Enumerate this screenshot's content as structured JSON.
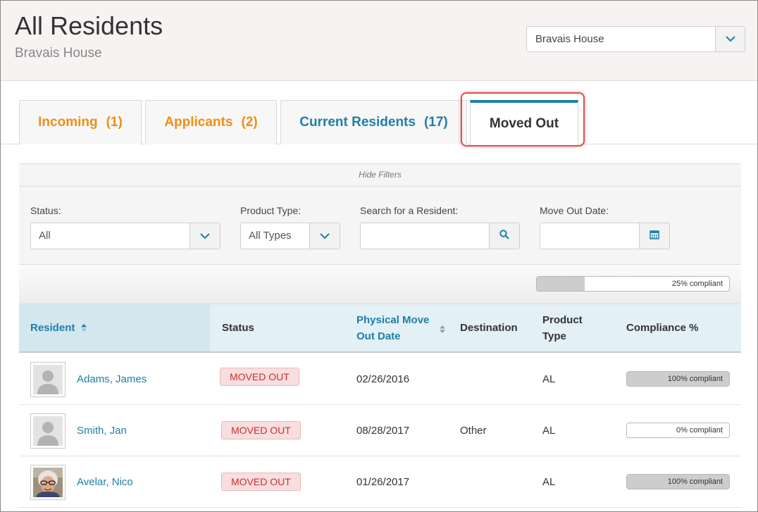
{
  "header": {
    "title": "All Residents",
    "subtitle": "Bravais House",
    "community_select": {
      "value": "Bravais House",
      "icon": "chevron-down-icon"
    }
  },
  "tabs": [
    {
      "label": "Incoming",
      "count": "(1)",
      "color": "#ef8f12",
      "active": false
    },
    {
      "label": "Applicants",
      "count": "(2)",
      "color": "#ef8f12",
      "active": false
    },
    {
      "label": "Current Residents",
      "count": "(17)",
      "color": "#1e7fa6",
      "active": false
    },
    {
      "label": "Moved Out",
      "count": "",
      "color": "#333333",
      "active": true
    }
  ],
  "filters": {
    "toggle_label": "Hide Filters",
    "status": {
      "label": "Status:",
      "value": "All"
    },
    "product_type": {
      "label": "Product Type:",
      "value": "All Types"
    },
    "search": {
      "label": "Search for a Resident:",
      "value": "",
      "placeholder": "",
      "icon": "search-icon"
    },
    "move_out_date": {
      "label": "Move Out Date:",
      "value": "",
      "icon": "calendar-icon"
    }
  },
  "overall_compliance": {
    "percent": 25,
    "label": "25% compliant"
  },
  "table": {
    "columns": {
      "resident": "Resident",
      "status": "Status",
      "move_out_line1": "Physical Move",
      "move_out_line2": "Out Date",
      "destination": "Destination",
      "product_line1": "Product",
      "product_line2": "Type",
      "compliance": "Compliance %"
    },
    "rows": [
      {
        "name": "Adams, James",
        "status": "MOVED OUT",
        "move_out_date": "02/26/2016",
        "destination": "",
        "product_type": "AL",
        "compliance_percent": 100,
        "compliance_label": "100% compliant",
        "photo": "default-avatar"
      },
      {
        "name": "Smith, Jan",
        "status": "MOVED OUT",
        "move_out_date": "08/28/2017",
        "destination": "Other",
        "product_type": "AL",
        "compliance_percent": 0,
        "compliance_label": "0% compliant",
        "photo": "default-avatar"
      },
      {
        "name": "Avelar, Nico",
        "status": "MOVED OUT",
        "move_out_date": "01/26/2017",
        "destination": "",
        "product_type": "AL",
        "compliance_percent": 100,
        "compliance_label": "100% compliant",
        "photo": "resident-photo"
      }
    ]
  },
  "colors": {
    "accent_blue": "#1e7fa6",
    "accent_orange": "#ef8f12",
    "badge_red": "#c9302c",
    "highlight_red": "#d9534f"
  }
}
